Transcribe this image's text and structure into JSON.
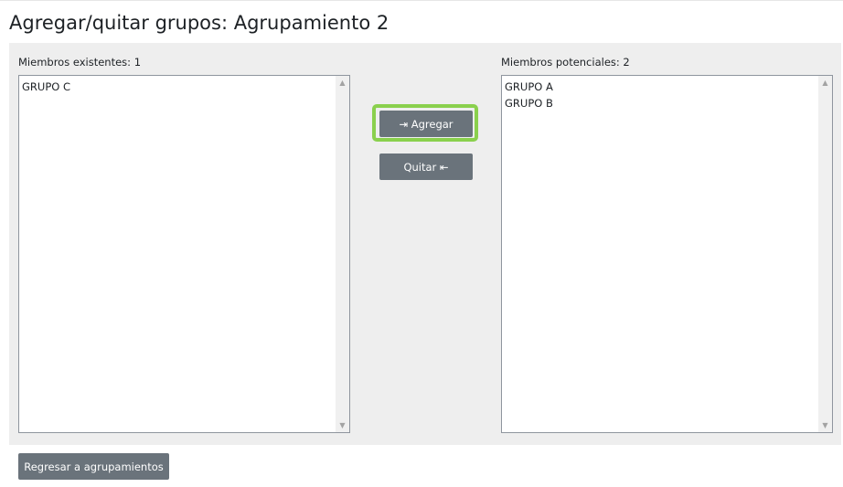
{
  "page": {
    "title": "Agregar/quitar grupos: Agrupamiento 2"
  },
  "existing": {
    "label": "Miembros existentes: 1",
    "options": [
      "GRUPO C"
    ]
  },
  "potential": {
    "label": "Miembros potenciales: 2",
    "options": [
      "GRUPO A",
      "GRUPO B"
    ]
  },
  "actions": {
    "add_label": "⇥ Agregar",
    "remove_label": "Quitar ⇤"
  },
  "footer": {
    "back_label": "Regresar a agrupamientos"
  },
  "colors": {
    "button_bg": "#6a737b",
    "focus_ring": "#8ad04d",
    "panel_bg": "#eeeeee"
  },
  "icons": {
    "add": "arrow-to-left-icon",
    "remove": "arrow-to-right-icon",
    "scroll_up": "chevron-up-icon",
    "scroll_down": "chevron-down-icon"
  }
}
